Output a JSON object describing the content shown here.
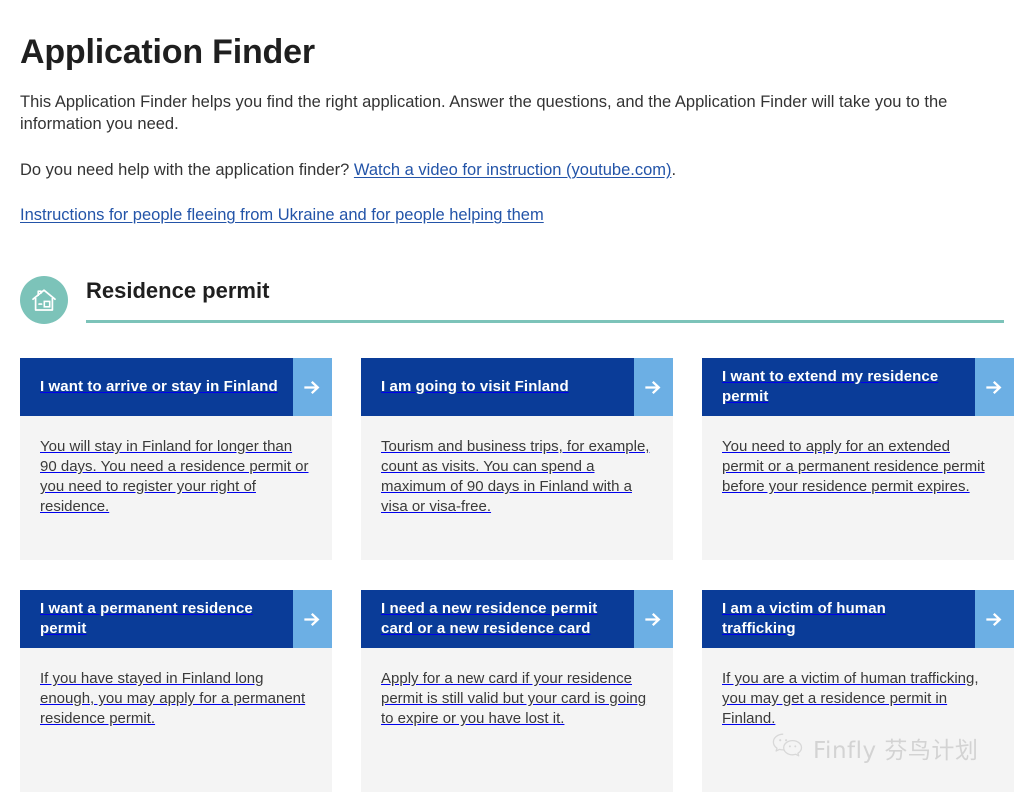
{
  "page": {
    "title": "Application Finder",
    "intro": "This Application Finder helps you find the right application. Answer the questions, and the Application Finder will take you to the information you need.",
    "help_prefix": "Do you need help with the application finder? ",
    "help_link": "Watch a video for instruction (youtube.com)",
    "help_suffix": ".",
    "ukraine_link": "Instructions for people fleeing from Ukraine and for people helping them"
  },
  "section": {
    "title": "Residence permit",
    "icon": "house-icon",
    "accent_color": "#7cc3b9"
  },
  "colors": {
    "card_header": "#0a3c98",
    "card_arrow": "#6cafe4",
    "card_body": "#f4f4f4",
    "link": "#2354a8"
  },
  "cards": [
    {
      "title": "I want to arrive or stay in Finland",
      "body": "You will stay in Finland for longer than 90 days. You need a residence permit or you need to register your right of residence.",
      "arrow": "arrow-right-icon"
    },
    {
      "title": "I am going to visit Finland",
      "body": "Tourism and business trips, for example, count as visits. You can spend a maximum of 90 days in Finland with a visa or visa-free.",
      "arrow": "arrow-right-icon"
    },
    {
      "title": "I want to extend my residence permit",
      "body": "You need to apply for an extended permit or a permanent residence permit before your residence permit expires.",
      "arrow": "arrow-right-icon"
    },
    {
      "title": "I want a permanent residence permit",
      "body": "If you have stayed in Finland long enough, you may apply for a permanent residence permit.",
      "arrow": "arrow-right-icon"
    },
    {
      "title": "I need a new residence permit card or a new residence card",
      "body": "Apply for a new card if your residence permit is still valid but your card is going to expire or you have lost it.",
      "arrow": "arrow-right-icon"
    },
    {
      "title": "I am a victim of human trafficking",
      "body": "If you are a victim of human trafficking, you may get a residence permit in Finland.",
      "arrow": "arrow-right-icon"
    }
  ],
  "watermark": {
    "text": "Finfly 芬鸟计划",
    "icon": "wechat-icon"
  }
}
